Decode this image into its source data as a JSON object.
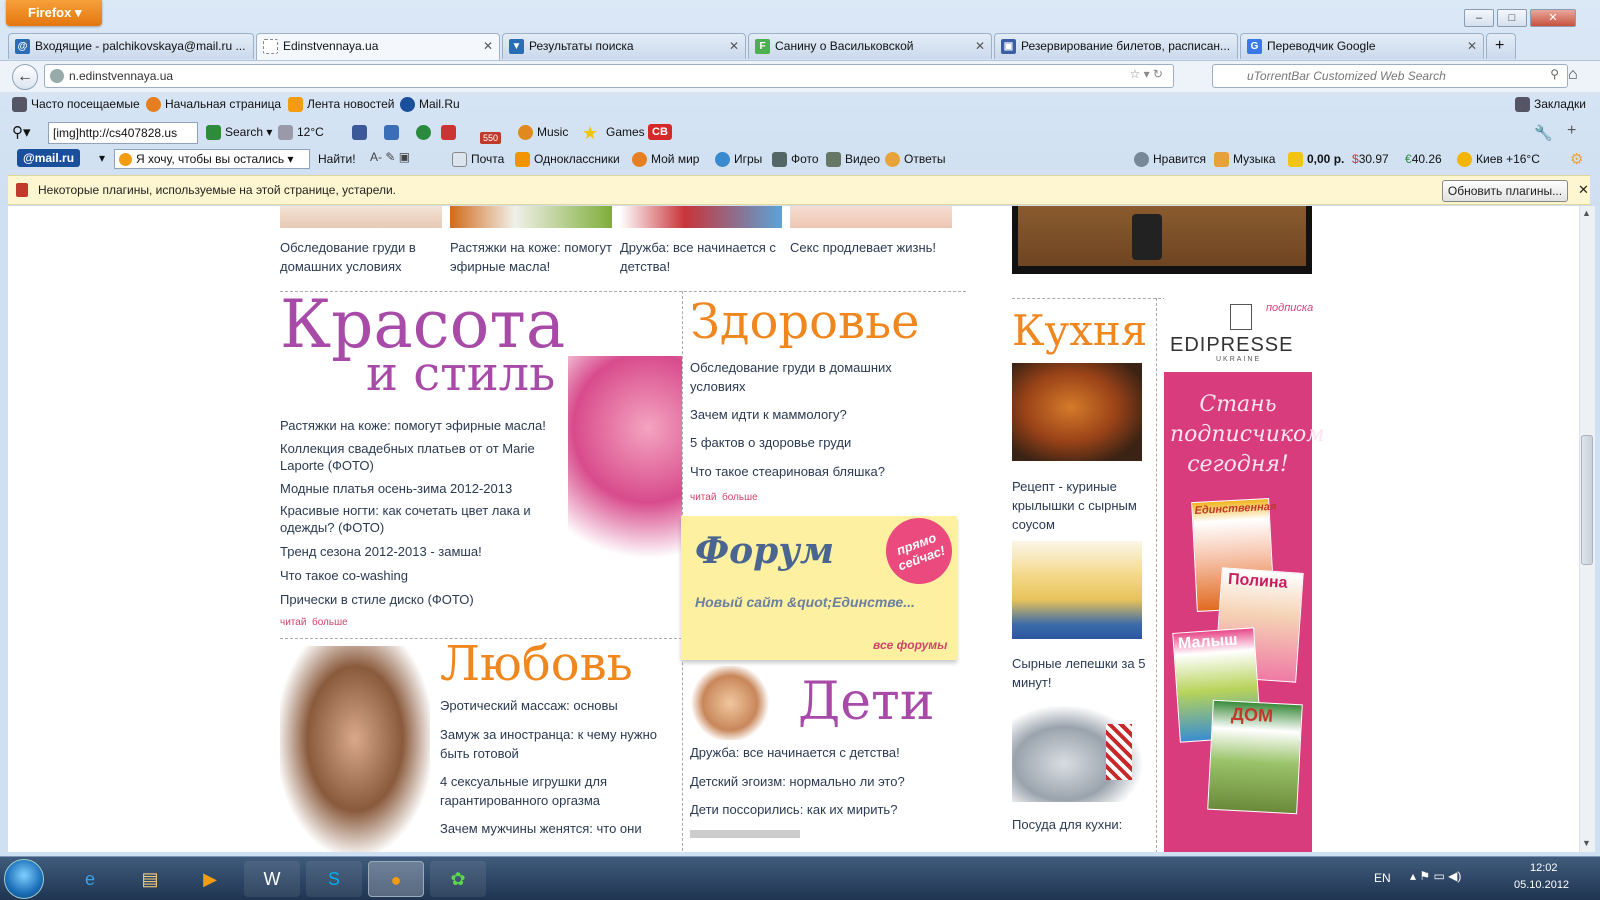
{
  "browser": {
    "app_button": "Firefox",
    "tabs": [
      {
        "label": "Входящие - palchikovskaya@mail.ru ...",
        "icon": "mail-icon",
        "color": "#2a6db5"
      },
      {
        "label": "Edinstvennaya.ua",
        "icon": "page-icon",
        "color": "#ffffff"
      },
      {
        "label": "Результаты поиска",
        "icon": "search-result-icon",
        "color": "#2a6db5"
      },
      {
        "label": "Санину о Васильковской",
        "icon": "f-icon",
        "color": "#4caf50"
      },
      {
        "label": "Резервирование билетов, расписан...",
        "icon": "booking-icon",
        "color": "#3a5fa5"
      },
      {
        "label": "Переводчик Google",
        "icon": "translate-icon",
        "color": "#3b78e7"
      }
    ],
    "new_tab": "+",
    "url": "n.edinstvennaya.ua",
    "search_placeholder": "uTorrentBar Customized Web Search",
    "bookmarks": [
      "Часто посещаемые",
      "Начальная страница",
      "Лента новостей",
      "Mail.Ru"
    ],
    "bookmarks_menu": "Закладки",
    "toolbar1": {
      "img_field": "[img]http://cs407828.us",
      "search": "Search",
      "weather": "12°C",
      "badge": "550",
      "music": "Music",
      "games": "Games",
      "cb": "CB"
    },
    "toolbar2": {
      "mailru": "@mail.ru",
      "query": "Я хочу, чтобы вы остались",
      "find": "Найти!",
      "items": [
        "Почта",
        "Одноклассники",
        "Мой мир",
        "Игры",
        "Фото",
        "Видео",
        "Ответы"
      ],
      "right": [
        "Нравится",
        "Музыка",
        "0,00 р.",
        "30.97",
        "40.26",
        "Киев +16°C"
      ],
      "usd_sign": "$",
      "eur_sign": "€"
    },
    "notification": {
      "text": "Некоторые плагины, используемые на этой странице, устарели.",
      "button": "Обновить плагины...",
      "close": "✕"
    }
  },
  "page": {
    "top_links": [
      "Обследование груди в домашних условиях",
      "Растяжки на коже: помогут эфирные масла!",
      "Дружба: все начинается с детства!",
      "Секс продлевает жизнь!"
    ],
    "beauty": {
      "title1": "Красота",
      "title2": "и стиль",
      "links": [
        "Растяжки на коже: помогут эфирные масла!",
        "Коллекция свадебных платьев от от Marie Laporte (ФОТО)",
        "Модные платья осень-зима 2012-2013",
        "Красивые ногти: как сочетать цвет лака и одежды? (ФОТО)",
        "Тренд сезона 2012-2013 - замша!",
        "Что такое co-washing",
        "Прически в стиле диско (ФОТО)"
      ],
      "more1": "читай",
      "more2": "больше"
    },
    "health": {
      "title": "Здоровье",
      "links": [
        "Обследование груди в домашних условиях",
        "Зачем идти к маммологу?",
        "5 фактов о здоровье груди",
        "Что такое стеариновая бляшка?"
      ],
      "more1": "читай",
      "more2": "больше"
    },
    "forum": {
      "title": "Форум",
      "badge": "прямо сейчас!",
      "text": "Новый сайт &quot;Единстве...",
      "all": "все форумы"
    },
    "love": {
      "title": "Любовь",
      "links": [
        "Эротический массаж: основы",
        "Замуж за иностранца: к чему нужно быть готовой",
        "4 сексуальные игрушки для гарантированного оргазма",
        "Зачем мужчины женятся: что они"
      ]
    },
    "kids": {
      "title": "Дети",
      "links": [
        "Дружба: все начинается с детства!",
        "Детский эгоизм: нормально ли это?",
        "Дети поссорились: как их мирить?"
      ]
    },
    "kitchen": {
      "title": "Кухня",
      "items": [
        "Рецепт - куриные крылышки с сырным соусом",
        "Сырные лепешки за 5 минут!",
        "Посуда для кухни:"
      ]
    },
    "ad": {
      "brand": "EDIPRESSE",
      "country": "UKRAINE",
      "tag": "подписка",
      "slogan": "Стань подписчиком сегодня!",
      "mag1": "Единственная",
      "mag2": "Полина",
      "mag3": "Малыш",
      "mag4": "ДОМ"
    }
  },
  "taskbar": {
    "lang": "EN",
    "time": "12:02",
    "date": "05.10.2012"
  },
  "colors": {
    "beauty": "#a84aa8",
    "orange": "#f0861e",
    "forum_bg": "#fdf0a0",
    "ad_bg": "#d83c7c"
  }
}
